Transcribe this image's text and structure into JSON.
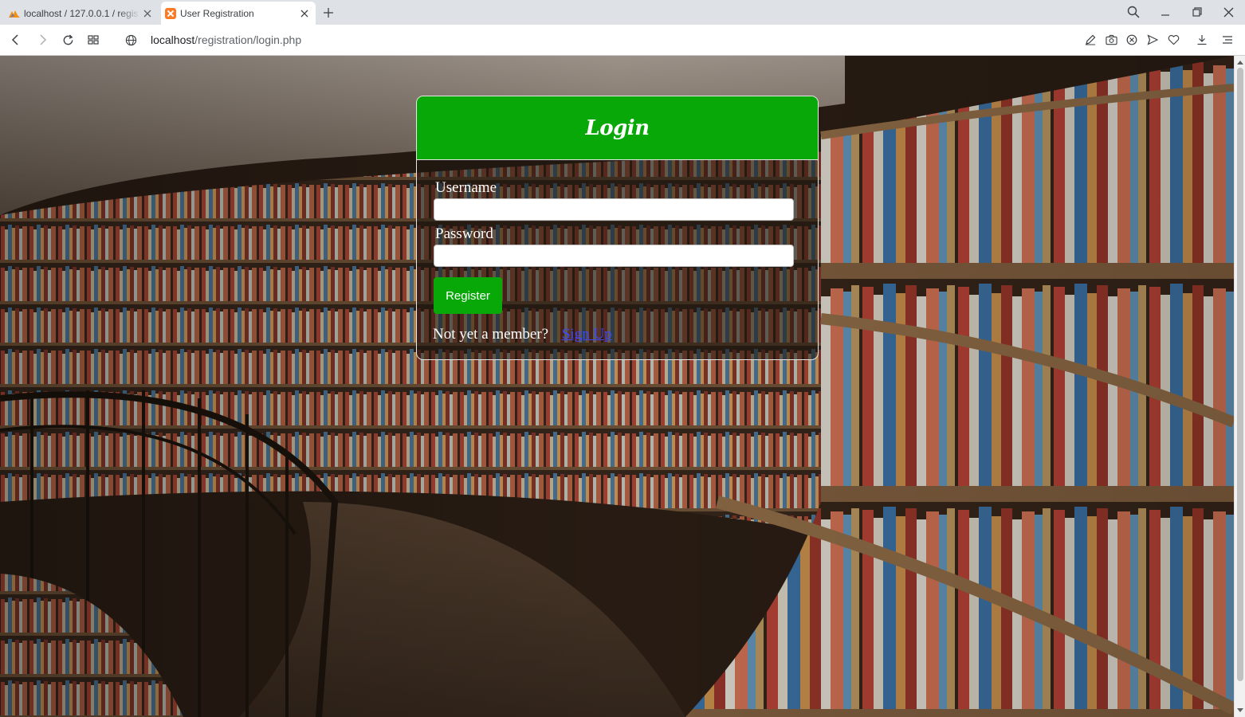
{
  "browser": {
    "tabs": [
      {
        "title": "localhost / 127.0.0.1 / regis",
        "active": false,
        "favicon": "phpmyadmin-icon"
      },
      {
        "title": "User Registration",
        "active": true,
        "favicon": "xampp-icon"
      }
    ],
    "url_host": "localhost",
    "url_path": "/registration/login.php"
  },
  "login": {
    "heading": "Login",
    "username_label": "Username",
    "username_value": "",
    "password_label": "Password",
    "password_value": "",
    "submit_label": "Register",
    "member_prompt": "Not yet a member?",
    "signup_link": "Sign Up"
  },
  "colors": {
    "accent_green": "#07a807",
    "link_blue": "#3a46ff"
  }
}
